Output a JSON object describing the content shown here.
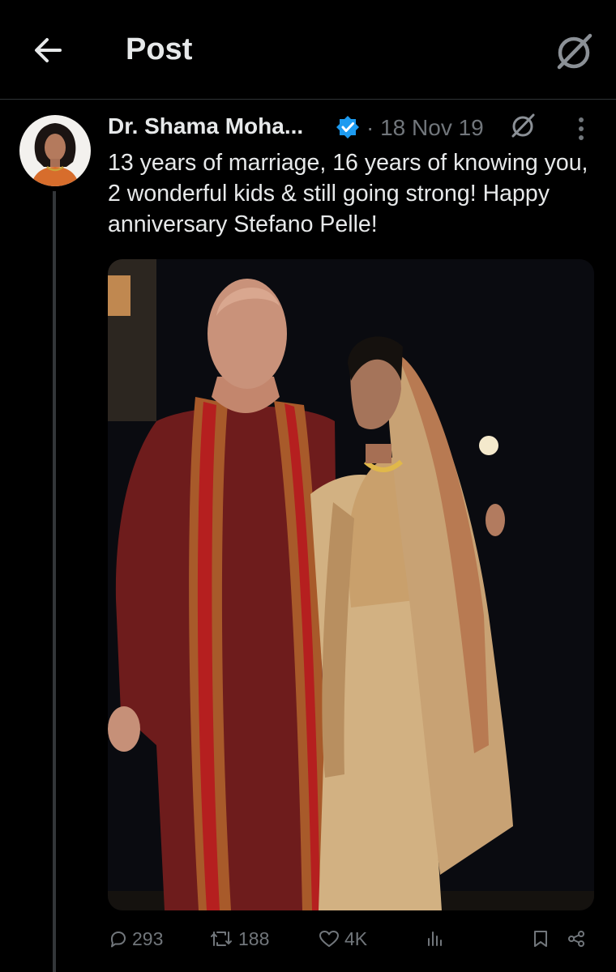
{
  "header": {
    "title": "Post"
  },
  "tweet": {
    "author_name": "Dr. Shama Moha...",
    "date": "18 Nov 19",
    "date_sep": "·",
    "text": "13 years of marriage, 16 years of knowing you, 2 wonderful kids & still going strong! Happy anniversary Stefano Pelle!",
    "stats": {
      "replies": "293",
      "reposts": "188",
      "likes": "4K"
    }
  },
  "icons": [
    "back-arrow-icon",
    "grok-icon",
    "verified-badge-icon",
    "more-icon",
    "reply-icon",
    "repost-icon",
    "like-icon",
    "views-icon",
    "bookmark-icon",
    "share-icon"
  ],
  "colors": {
    "background": "#000000",
    "text": "#e7e9ea",
    "muted": "#71767b",
    "verified": "#1d9bf0",
    "divider": "#2f3336"
  }
}
